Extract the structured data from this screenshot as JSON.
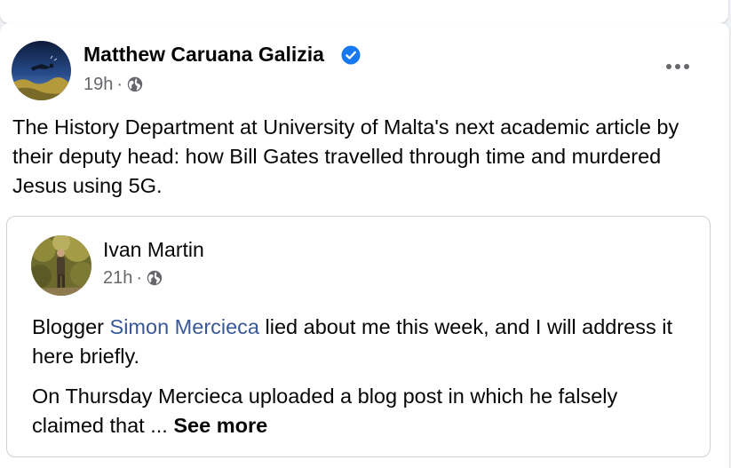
{
  "post": {
    "author": "Matthew Caruana Galizia",
    "time": "19h",
    "separator": "·",
    "text": "The History Department at University of Malta's next academic article by their deputy head: how Bill Gates travelled through time and murdered Jesus using 5G.",
    "icons": [
      "verified-badge-icon",
      "globe-icon",
      "more-options-icon"
    ],
    "accent_color": "#1877f2"
  },
  "shared_post": {
    "author": "Ivan Martin",
    "time": "21h",
    "separator": "·",
    "para1_before": "Blogger ",
    "mention": "Simon Mercieca",
    "para1_after": " lied about me this week, and I will address it here briefly.",
    "para2": "On Thursday Mercieca uploaded a blog post in which he falsely claimed that ... ",
    "see_more": "See more",
    "mention_color": "#385898"
  }
}
